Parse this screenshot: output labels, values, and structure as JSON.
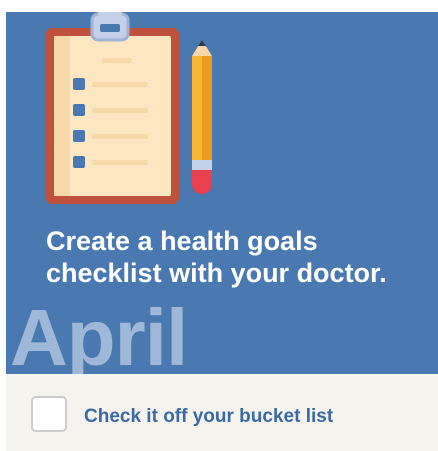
{
  "card": {
    "headline": "Create a health goals checklist with your doctor.",
    "month": "April",
    "illustration_icons": [
      "clipboard-icon",
      "pencil-icon"
    ],
    "background_color": "#4a78b1"
  },
  "footer": {
    "checkbox_checked": false,
    "checkbox_label": "Check it off your bucket list",
    "accent_color": "#3b6aa3"
  }
}
